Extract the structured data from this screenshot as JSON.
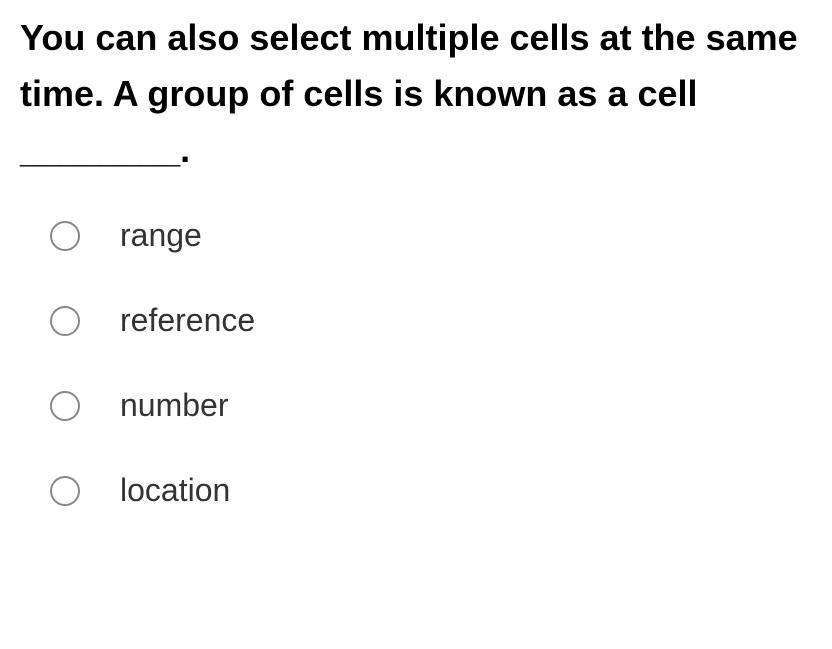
{
  "question": {
    "text": "You can also select multiple cells at the same time. A group of cells is known as a cell ________."
  },
  "options": [
    {
      "label": "range"
    },
    {
      "label": "reference"
    },
    {
      "label": "number"
    },
    {
      "label": "location"
    }
  ]
}
